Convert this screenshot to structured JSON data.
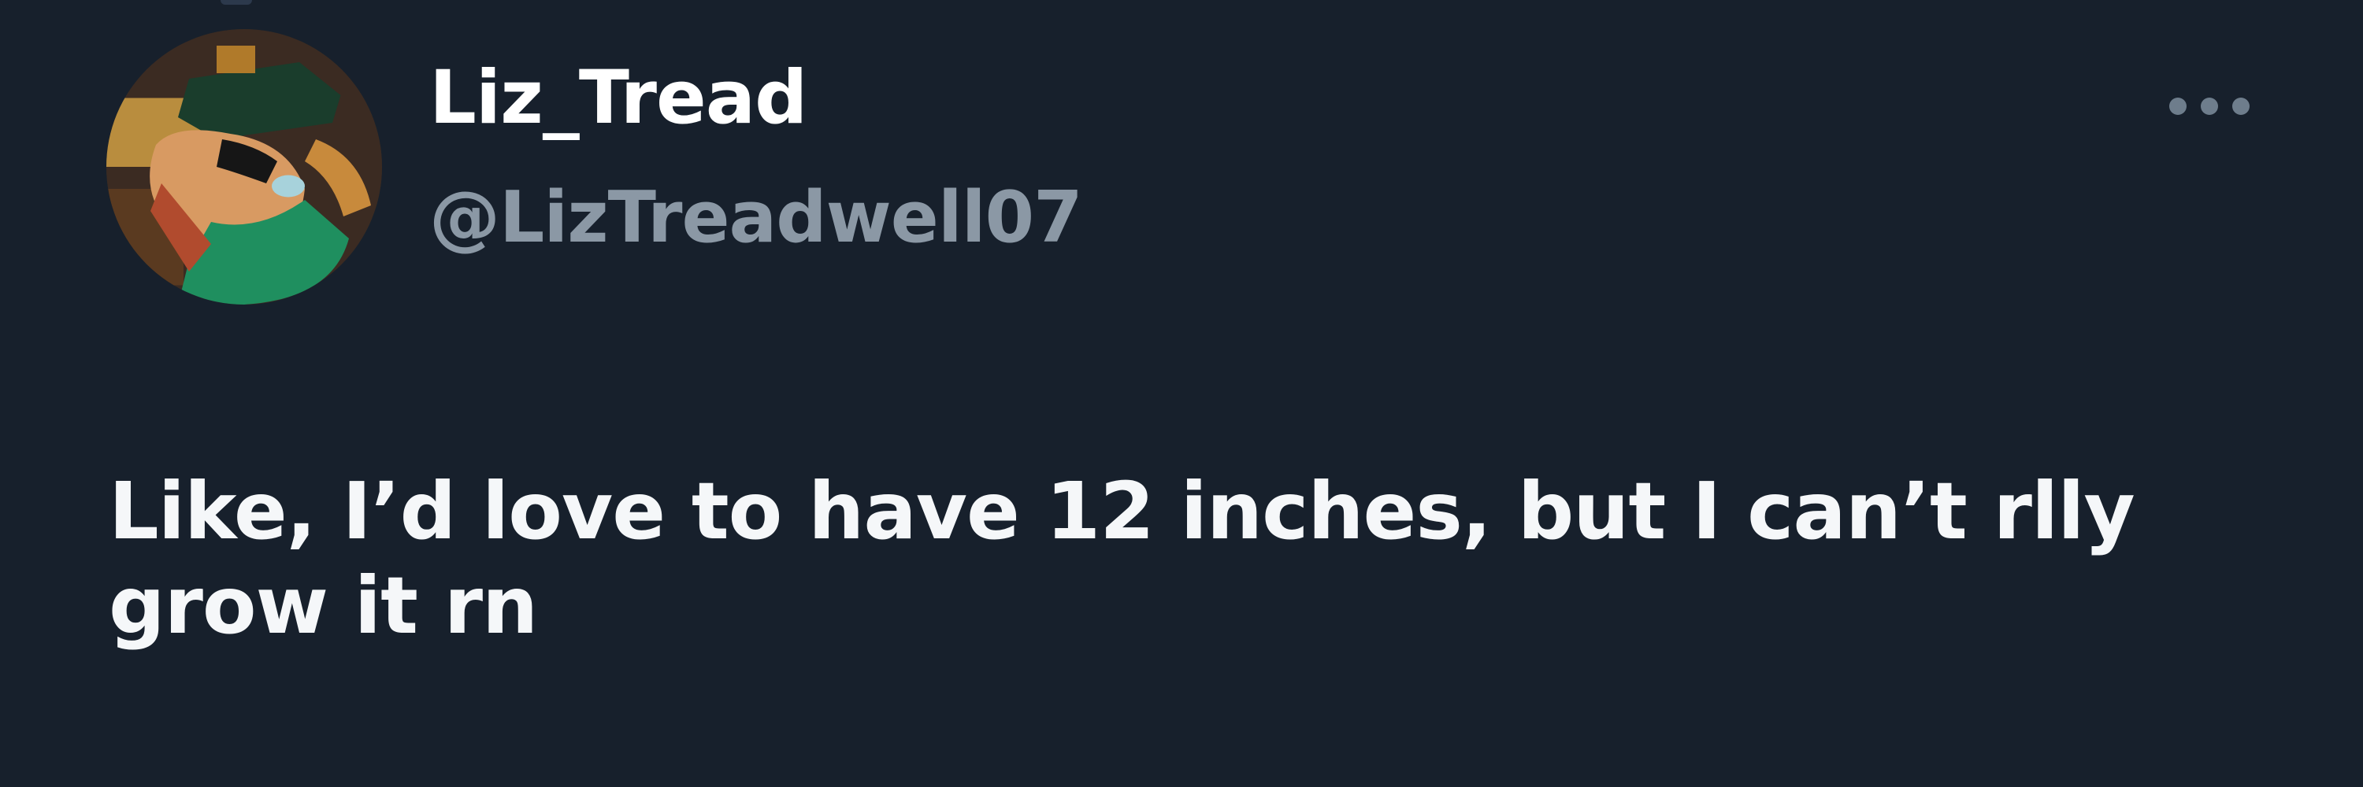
{
  "tweet": {
    "author": {
      "display_name": "Liz_Tread",
      "handle": "@LizTreadwell07",
      "avatar_icon": "avatar-illustration-icon"
    },
    "text": "Like, I’d love to have 12 inches, but I can’t rlly grow it rn",
    "more_icon": "more-horizontal-icon"
  },
  "colors": {
    "background": "#17202c",
    "display_name": "#ffffff",
    "handle": "#8b98a5",
    "body_text": "#f5f7f9",
    "more_icon": "#6e7d8c"
  }
}
